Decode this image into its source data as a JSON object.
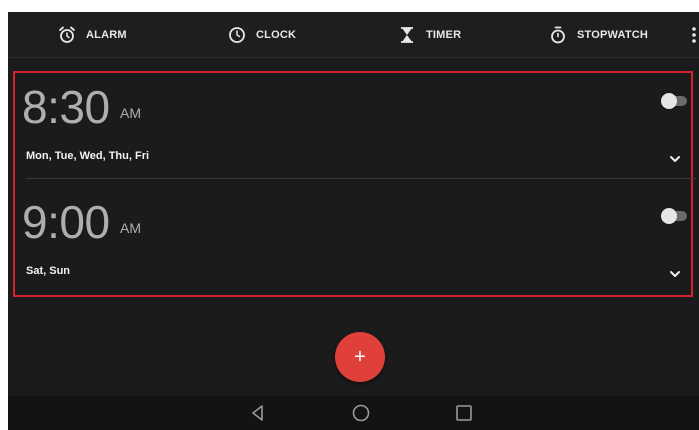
{
  "tabs": [
    {
      "label": "ALARM",
      "icon": "alarm-clock-icon"
    },
    {
      "label": "CLOCK",
      "icon": "clock-icon"
    },
    {
      "label": "TIMER",
      "icon": "hourglass-icon"
    },
    {
      "label": "STOPWATCH",
      "icon": "stopwatch-icon"
    }
  ],
  "alarms": [
    {
      "time": "8:30",
      "ampm": "AM",
      "days": "Mon, Tue, Wed, Thu, Fri",
      "enabled": false
    },
    {
      "time": "9:00",
      "ampm": "AM",
      "days": "Sat, Sun",
      "enabled": false
    }
  ],
  "fab": {
    "label": "+",
    "icon": "add-icon"
  },
  "colors": {
    "background": "#1b1b1c",
    "accent": "#e0403a",
    "selection_outline": "#d5212e",
    "time_text": "#aeaeae"
  },
  "navbar": {
    "icons": [
      "back-icon",
      "home-icon",
      "recent-apps-icon"
    ]
  }
}
